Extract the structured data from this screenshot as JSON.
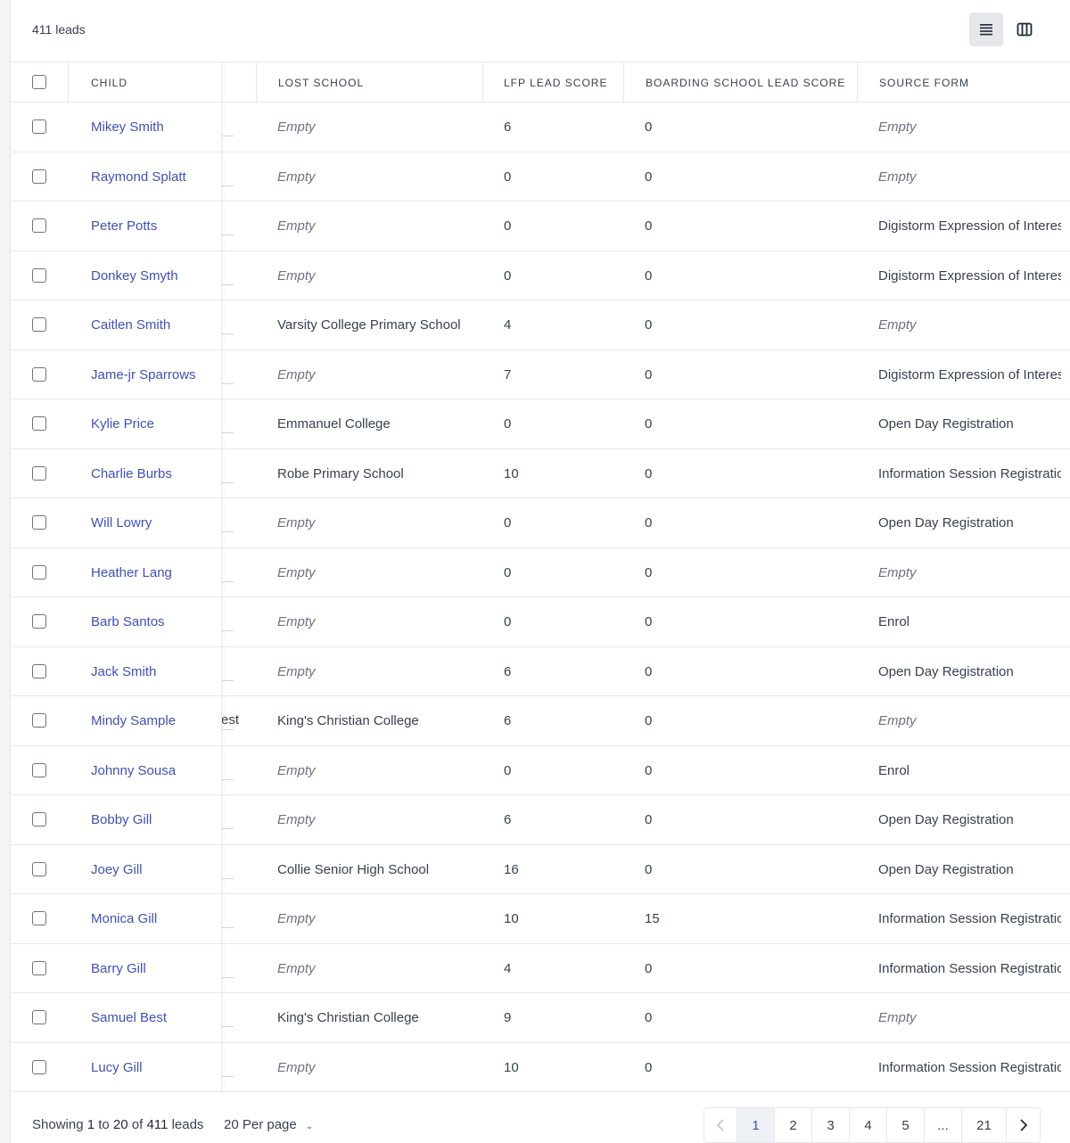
{
  "header": {
    "lead_count": "411 leads"
  },
  "icons": {
    "list_view": "list-view-icon",
    "column_view": "columns-icon"
  },
  "columns": {
    "child": "CHILD",
    "lost_school": "LOST SCHOOL",
    "lfp_score": "LFP LEAD SCORE",
    "boarding_score": "BOARDING SCHOOL LEAD SCORE",
    "source_form": "SOURCE FORM"
  },
  "rows": [
    {
      "child": "Mikey Smith",
      "lost_school": "Empty",
      "lfp": "6",
      "boarding": "0",
      "source": "Empty"
    },
    {
      "child": "Raymond Splatt",
      "lost_school": "Empty",
      "lfp": "0",
      "boarding": "0",
      "source": "Empty"
    },
    {
      "child": "Peter Potts",
      "lost_school": "Empty",
      "lfp": "0",
      "boarding": "0",
      "source": "Digistorm Expression of Interes"
    },
    {
      "child": "Donkey Smyth",
      "lost_school": "Empty",
      "lfp": "0",
      "boarding": "0",
      "source": "Digistorm Expression of Interes"
    },
    {
      "child": "Caitlen Smith",
      "lost_school": "Varsity College Primary School",
      "lfp": "4",
      "boarding": "0",
      "source": "Empty"
    },
    {
      "child": "Jame-jr Sparrows",
      "lost_school": "Empty",
      "lfp": "7",
      "boarding": "0",
      "source": "Digistorm Expression of Interes"
    },
    {
      "child": "Kylie Price",
      "lost_school": "Emmanuel College",
      "lfp": "0",
      "boarding": "0",
      "source": "Open Day Registration"
    },
    {
      "child": "Charlie Burbs",
      "lost_school": "Robe Primary School",
      "lfp": "10",
      "boarding": "0",
      "source": "Information Session Registratio"
    },
    {
      "child": "Will Lowry",
      "lost_school": "Empty",
      "lfp": "0",
      "boarding": "0",
      "source": "Open Day Registration"
    },
    {
      "child": "Heather Lang",
      "lost_school": "Empty",
      "lfp": "0",
      "boarding": "0",
      "source": "Empty"
    },
    {
      "child": "Barb Santos",
      "lost_school": "Empty",
      "lfp": "0",
      "boarding": "0",
      "source": "Enrol"
    },
    {
      "child": "Jack Smith",
      "lost_school": "Empty",
      "lfp": "6",
      "boarding": "0",
      "source": "Open Day Registration"
    },
    {
      "child": "Mindy Sample",
      "peek": "est",
      "lost_school": "King's Christian College",
      "lfp": "6",
      "boarding": "0",
      "source": "Empty"
    },
    {
      "child": "Johnny Sousa",
      "lost_school": "Empty",
      "lfp": "0",
      "boarding": "0",
      "source": "Enrol"
    },
    {
      "child": "Bobby Gill",
      "lost_school": "Empty",
      "lfp": "6",
      "boarding": "0",
      "source": "Open Day Registration"
    },
    {
      "child": "Joey Gill",
      "lost_school": "Collie Senior High School",
      "lfp": "16",
      "boarding": "0",
      "source": "Open Day Registration"
    },
    {
      "child": "Monica Gill",
      "lost_school": "Empty",
      "lfp": "10",
      "boarding": "15",
      "source": "Information Session Registratio"
    },
    {
      "child": "Barry Gill",
      "lost_school": "Empty",
      "lfp": "4",
      "boarding": "0",
      "source": "Information Session Registratio"
    },
    {
      "child": "Samuel Best",
      "lost_school": "King's Christian College",
      "lfp": "9",
      "boarding": "0",
      "source": "Empty"
    },
    {
      "child": "Lucy Gill",
      "lost_school": "Empty",
      "lfp": "10",
      "boarding": "0",
      "source": "Information Session Registratio"
    }
  ],
  "footer": {
    "showing_prefix": "Showing",
    "from": "1",
    "to_word": "to",
    "to": "20",
    "of_word": "of",
    "total": "411",
    "suffix": "leads",
    "per_page": "20 Per page",
    "pages": [
      "1",
      "2",
      "3",
      "4",
      "5",
      "...",
      "21"
    ],
    "current_page": "1",
    "prev_icon": "chevron-left-icon",
    "next_icon": "chevron-right-icon"
  }
}
